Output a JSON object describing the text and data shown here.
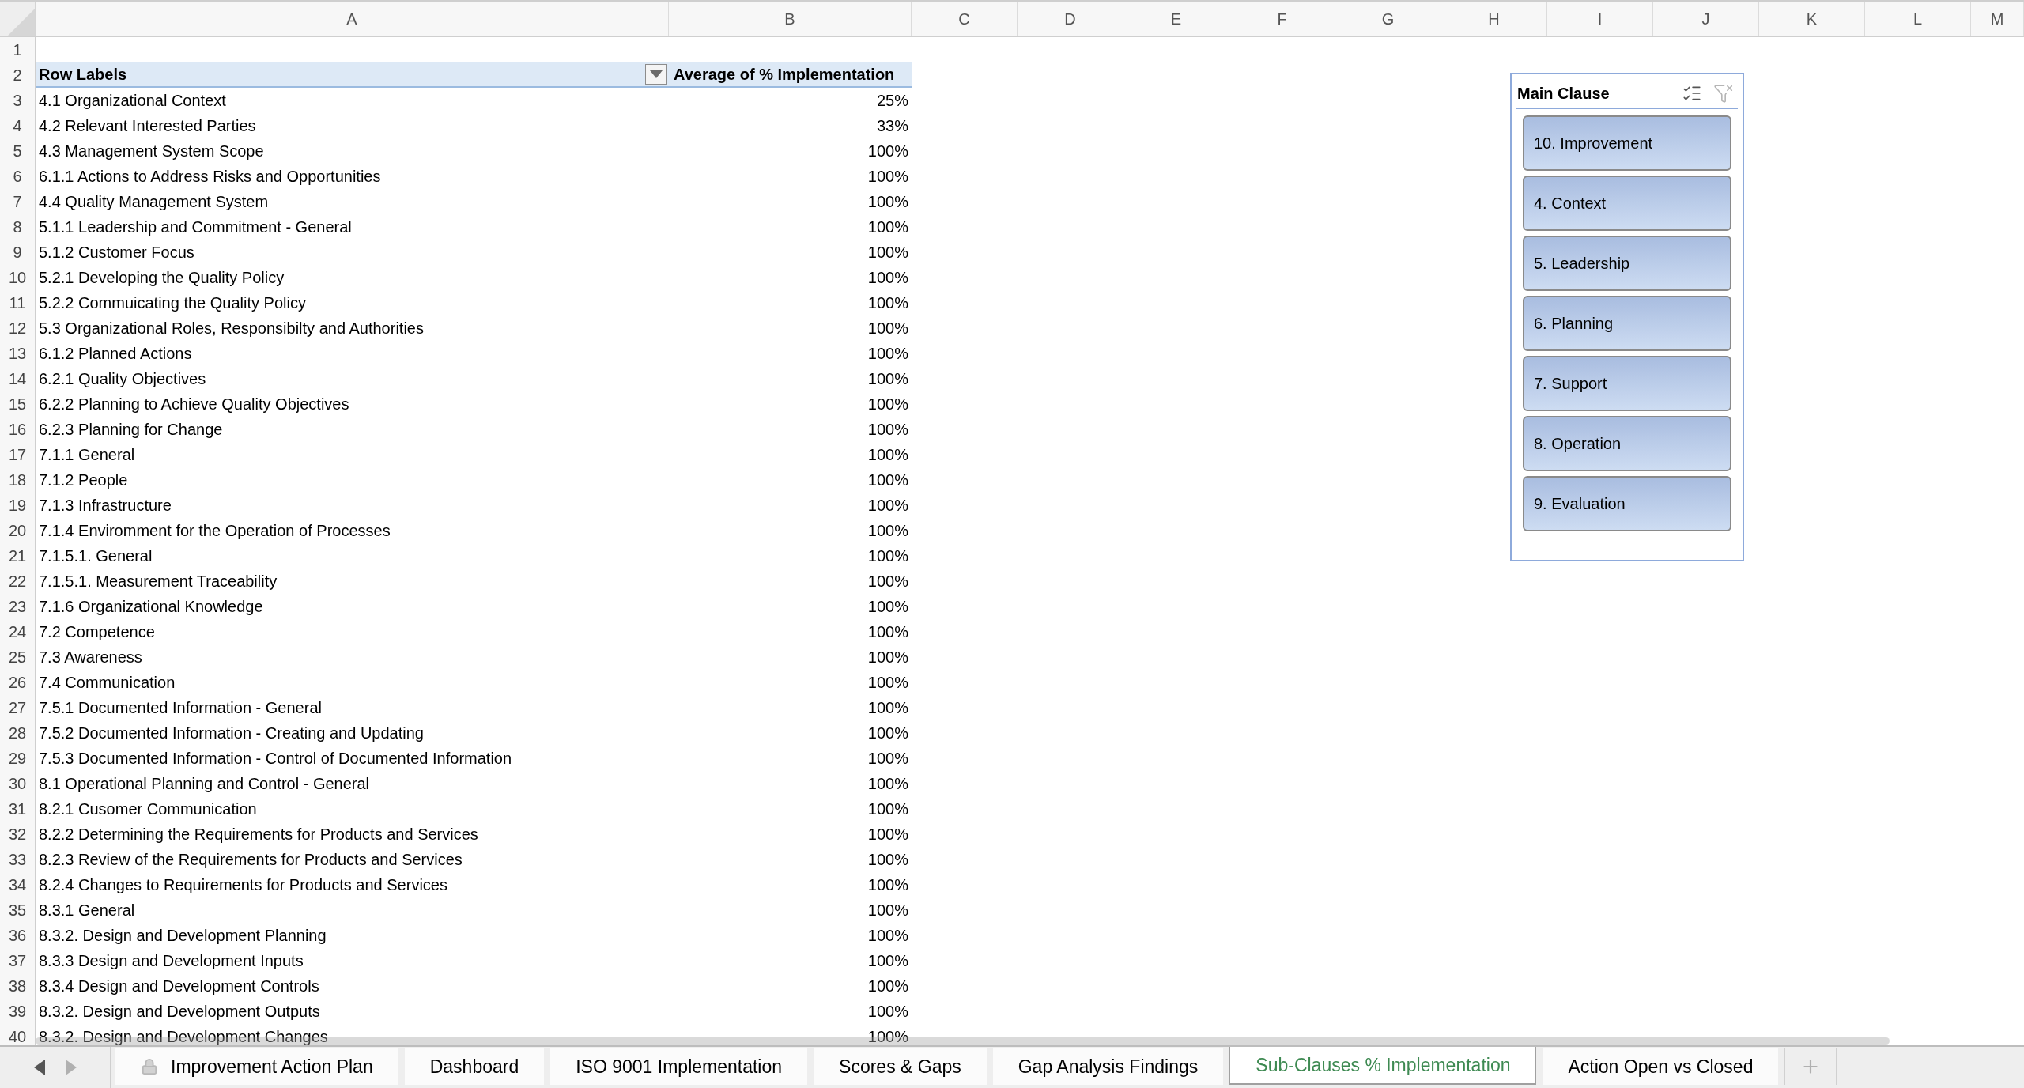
{
  "columns": [
    "A",
    "B",
    "C",
    "D",
    "E",
    "F",
    "G",
    "H",
    "I",
    "J",
    "K",
    "L",
    "M"
  ],
  "rows": [
    {
      "number": "1",
      "kind": "blank"
    },
    {
      "number": "2",
      "kind": "header",
      "label": "Row Labels",
      "value": "Average of % Implementation"
    },
    {
      "number": "3",
      "kind": "data",
      "label": "4.1 Organizational Context",
      "value": "25%"
    },
    {
      "number": "4",
      "kind": "data",
      "label": "4.2 Relevant Interested Parties",
      "value": "33%"
    },
    {
      "number": "5",
      "kind": "data",
      "label": "4.3 Management System Scope",
      "value": "100%"
    },
    {
      "number": "6",
      "kind": "data",
      "label": "6.1.1 Actions to Address Risks and Opportunities",
      "value": "100%"
    },
    {
      "number": "7",
      "kind": "data",
      "label": "4.4 Quality Management System",
      "value": "100%"
    },
    {
      "number": "8",
      "kind": "data",
      "label": "5.1.1 Leadership and Commitment - General",
      "value": "100%"
    },
    {
      "number": "9",
      "kind": "data",
      "label": "5.1.2 Customer Focus",
      "value": "100%"
    },
    {
      "number": "10",
      "kind": "data",
      "label": "5.2.1 Developing the Quality Policy",
      "value": "100%"
    },
    {
      "number": "11",
      "kind": "data",
      "label": "5.2.2 Commuicating the Quality Policy",
      "value": "100%"
    },
    {
      "number": "12",
      "kind": "data",
      "label": "5.3 Organizational Roles, Responsibilty and Authorities",
      "value": "100%"
    },
    {
      "number": "13",
      "kind": "data",
      "label": "6.1.2 Planned Actions",
      "value": "100%"
    },
    {
      "number": "14",
      "kind": "data",
      "label": "6.2.1 Quality Objectives",
      "value": "100%"
    },
    {
      "number": "15",
      "kind": "data",
      "label": "6.2.2 Planning to Achieve Quality Objectives",
      "value": "100%"
    },
    {
      "number": "16",
      "kind": "data",
      "label": "6.2.3 Planning for Change",
      "value": "100%"
    },
    {
      "number": "17",
      "kind": "data",
      "label": "7.1.1 General",
      "value": "100%"
    },
    {
      "number": "18",
      "kind": "data",
      "label": "7.1.2 People",
      "value": "100%"
    },
    {
      "number": "19",
      "kind": "data",
      "label": "7.1.3 Infrastructure",
      "value": "100%"
    },
    {
      "number": "20",
      "kind": "data",
      "label": "7.1.4 Enviromment for the Operation of Processes",
      "value": "100%"
    },
    {
      "number": "21",
      "kind": "data",
      "label": "7.1.5.1. General",
      "value": "100%"
    },
    {
      "number": "22",
      "kind": "data",
      "label": "7.1.5.1. Measurement Traceability",
      "value": "100%"
    },
    {
      "number": "23",
      "kind": "data",
      "label": "7.1.6 Organizational Knowledge",
      "value": "100%"
    },
    {
      "number": "24",
      "kind": "data",
      "label": "7.2 Competence",
      "value": "100%"
    },
    {
      "number": "25",
      "kind": "data",
      "label": "7.3 Awareness",
      "value": "100%"
    },
    {
      "number": "26",
      "kind": "data",
      "label": "7.4 Communication",
      "value": "100%"
    },
    {
      "number": "27",
      "kind": "data",
      "label": "7.5.1 Documented Information - General",
      "value": "100%"
    },
    {
      "number": "28",
      "kind": "data",
      "label": "7.5.2 Documented Information - Creating and Updating",
      "value": "100%"
    },
    {
      "number": "29",
      "kind": "data",
      "label": "7.5.3 Documented Information - Control of Documented Information",
      "value": "100%"
    },
    {
      "number": "30",
      "kind": "data",
      "label": "8.1 Operational Planning and Control - General",
      "value": "100%"
    },
    {
      "number": "31",
      "kind": "data",
      "label": "8.2.1 Cusomer Communication",
      "value": "100%"
    },
    {
      "number": "32",
      "kind": "data",
      "label": "8.2.2 Determining the Requirements for Products and Services",
      "value": "100%"
    },
    {
      "number": "33",
      "kind": "data",
      "label": "8.2.3 Review of the Requirements for Products and Services",
      "value": "100%"
    },
    {
      "number": "34",
      "kind": "data",
      "label": "8.2.4 Changes to Requirements for Products and Services",
      "value": "100%"
    },
    {
      "number": "35",
      "kind": "data",
      "label": "8.3.1 General",
      "value": "100%"
    },
    {
      "number": "36",
      "kind": "data",
      "label": "8.3.2. Design and Development Planning",
      "value": "100%"
    },
    {
      "number": "37",
      "kind": "data",
      "label": "8.3.3 Design and Development Inputs",
      "value": "100%"
    },
    {
      "number": "38",
      "kind": "data",
      "label": "8.3.4 Design and Development Controls",
      "value": "100%"
    },
    {
      "number": "39",
      "kind": "data",
      "label": "8.3.2. Design and Development Outputs",
      "value": "100%"
    },
    {
      "number": "40",
      "kind": "data",
      "label": "8.3.2. Design and Development Changes",
      "value": "100%"
    }
  ],
  "slicer": {
    "title": "Main Clause",
    "items": [
      {
        "label": "10. Improvement",
        "selected": true
      },
      {
        "label": "4. Context",
        "selected": true
      },
      {
        "label": "5. Leadership",
        "selected": true
      },
      {
        "label": "6. Planning",
        "selected": true
      },
      {
        "label": "7. Support",
        "selected": true
      },
      {
        "label": "8. Operation",
        "selected": true
      },
      {
        "label": "9. Evaluation",
        "selected": true
      }
    ]
  },
  "sheet_tabs": [
    {
      "label": "Improvement Action Plan",
      "selected": false,
      "locked": true
    },
    {
      "label": "Dashboard",
      "selected": false,
      "locked": false
    },
    {
      "label": "ISO 9001 Implementation",
      "selected": false,
      "locked": false
    },
    {
      "label": "Scores & Gaps",
      "selected": false,
      "locked": false
    },
    {
      "label": "Gap Analysis Findings",
      "selected": false,
      "locked": false
    },
    {
      "label": "Sub-Clauses % Implementation",
      "selected": true,
      "locked": false
    },
    {
      "label": "Action Open vs Closed",
      "selected": false,
      "locked": false
    }
  ]
}
